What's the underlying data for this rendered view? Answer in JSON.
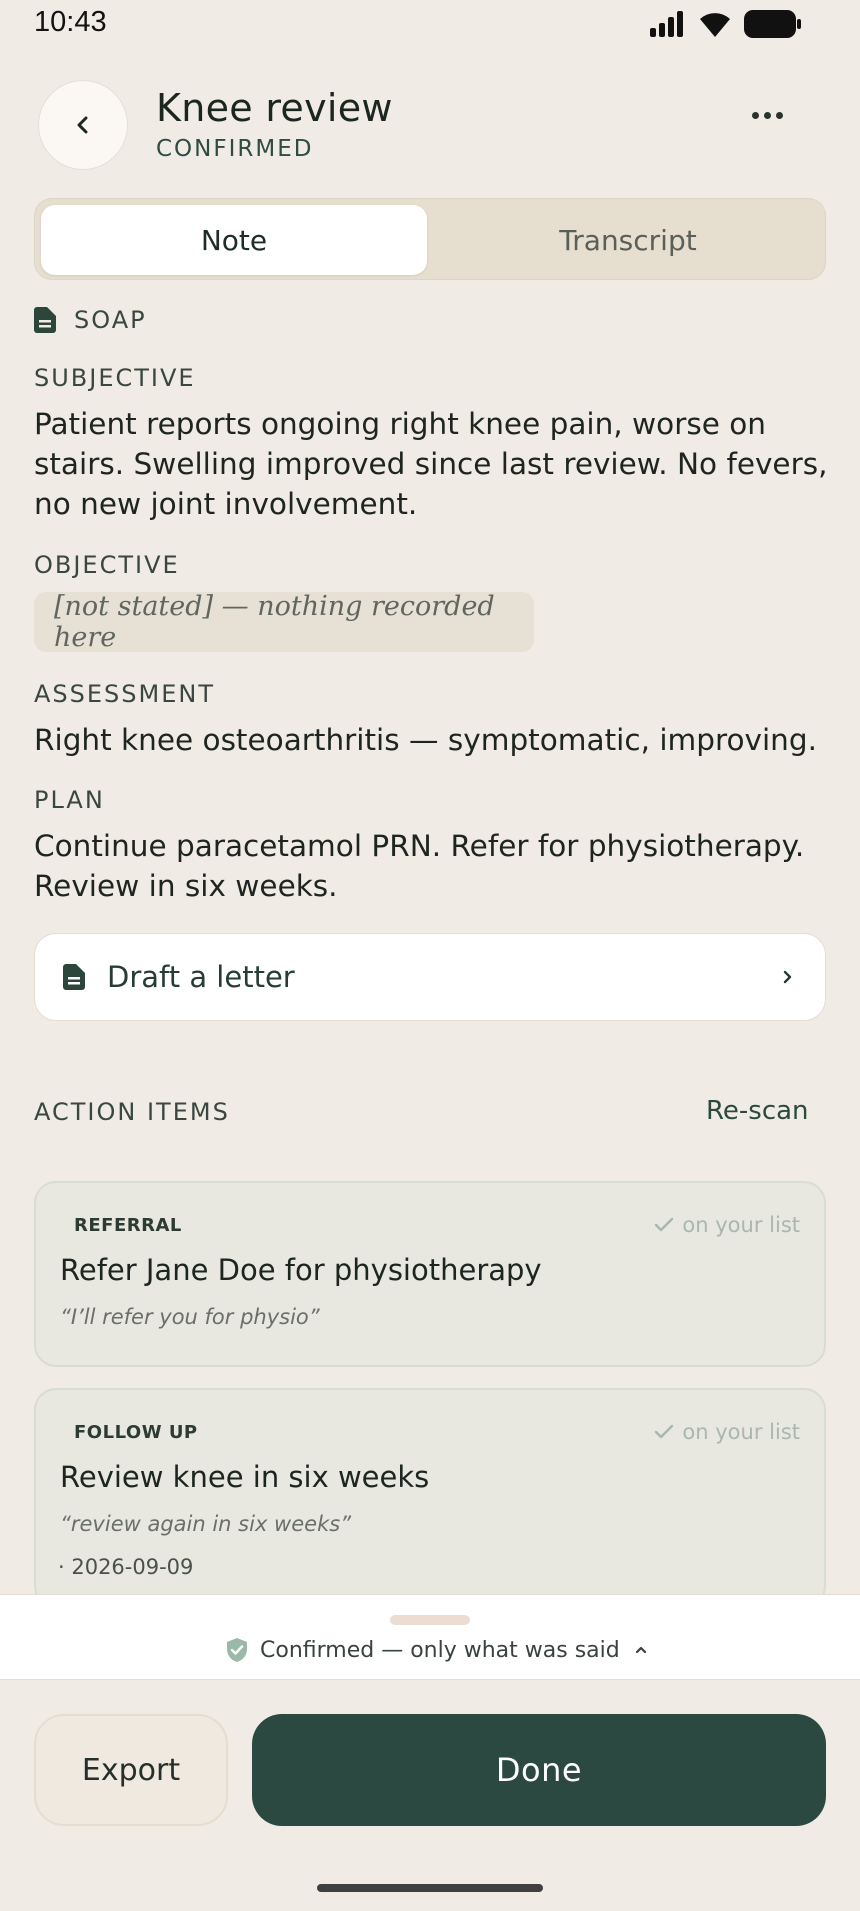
{
  "status_bar": {
    "time": "10:43"
  },
  "header": {
    "title": "Knee review",
    "status": "CONFIRMED"
  },
  "tabs": [
    {
      "label": "Note",
      "selected": true
    },
    {
      "label": "Transcript",
      "selected": false
    }
  ],
  "note": {
    "format_label": "SOAP",
    "sections": {
      "subjective": {
        "label": "SUBJECTIVE",
        "text": "Patient reports ongoing right knee pain, worse on stairs. Swelling improved since last review. No fevers, no new joint involvement."
      },
      "objective": {
        "label": "OBJECTIVE",
        "text": "[not stated] — nothing recorded here"
      },
      "assessment": {
        "label": "ASSESSMENT",
        "text": "Right knee osteoarthritis — symptomatic, improving."
      },
      "plan": {
        "label": "PLAN",
        "text": "Continue paracetamol PRN. Refer for physiotherapy. Review in six weeks."
      }
    },
    "draft_letter_label": "Draft a letter"
  },
  "action_items": {
    "title": "ACTION ITEMS",
    "rescan_label": "Re-scan",
    "items": [
      {
        "tag": "REFERRAL",
        "status": "on your list",
        "title": "Refer Jane Doe for physiotherapy",
        "quote": "“I’ll refer you for physio”"
      },
      {
        "tag": "FOLLOW UP",
        "status": "on your list",
        "title": "Review knee in six weeks",
        "quote": "“review again in six weeks”",
        "date": "· 2026-09-09"
      }
    ]
  },
  "confirmation_sheet": {
    "text": "Confirmed — only what was said"
  },
  "footer": {
    "export_label": "Export",
    "done_label": "Done"
  },
  "colors": {
    "accent": "#2b4940",
    "background": "#f0ebe5",
    "confirmed_check": "#9bb8a9"
  }
}
